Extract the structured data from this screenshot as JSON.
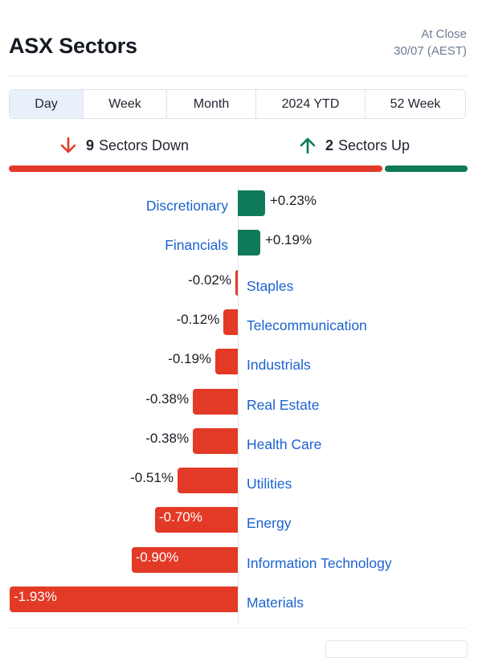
{
  "header": {
    "title": "ASX Sectors",
    "status_line1": "At Close",
    "status_line2": "30/07 (AEST)"
  },
  "tabs": [
    {
      "label": "Day",
      "active": true
    },
    {
      "label": "Week",
      "active": false
    },
    {
      "label": "Month",
      "active": false
    },
    {
      "label": "2024 YTD",
      "active": false
    },
    {
      "label": "52 Week",
      "active": false
    }
  ],
  "summary": {
    "down_count": "9",
    "down_label": "Sectors Down",
    "down_icon": "arrow-down-icon",
    "up_count": "2",
    "up_label": "Sectors Up",
    "up_icon": "arrow-up-icon",
    "down_fraction": 0.818,
    "up_fraction": 0.182
  },
  "colors": {
    "up": "#0e7a5a",
    "down": "#e33a27",
    "link": "#1c63d0",
    "muted": "#6c7d90"
  },
  "chart_data": {
    "type": "bar",
    "orientation": "horizontal-diverging",
    "title": "ASX Sectors",
    "xlabel": "",
    "ylabel": "",
    "unit": "%",
    "categories": [
      "Discretionary",
      "Financials",
      "Staples",
      "Telecommunication",
      "Industrials",
      "Real Estate",
      "Health Care",
      "Utilities",
      "Energy",
      "Information Technology",
      "Materials"
    ],
    "values": [
      0.23,
      0.19,
      -0.02,
      -0.12,
      -0.19,
      -0.38,
      -0.38,
      -0.51,
      -0.7,
      -0.9,
      -1.93
    ],
    "labels": [
      "+0.23%",
      "+0.19%",
      "-0.02%",
      "-0.12%",
      "-0.19%",
      "-0.38%",
      "-0.38%",
      "-0.51%",
      "-0.70%",
      "-0.90%",
      "-1.93%"
    ],
    "xlim": [
      -1.93,
      0.23
    ],
    "grid": false,
    "legend": "none"
  }
}
